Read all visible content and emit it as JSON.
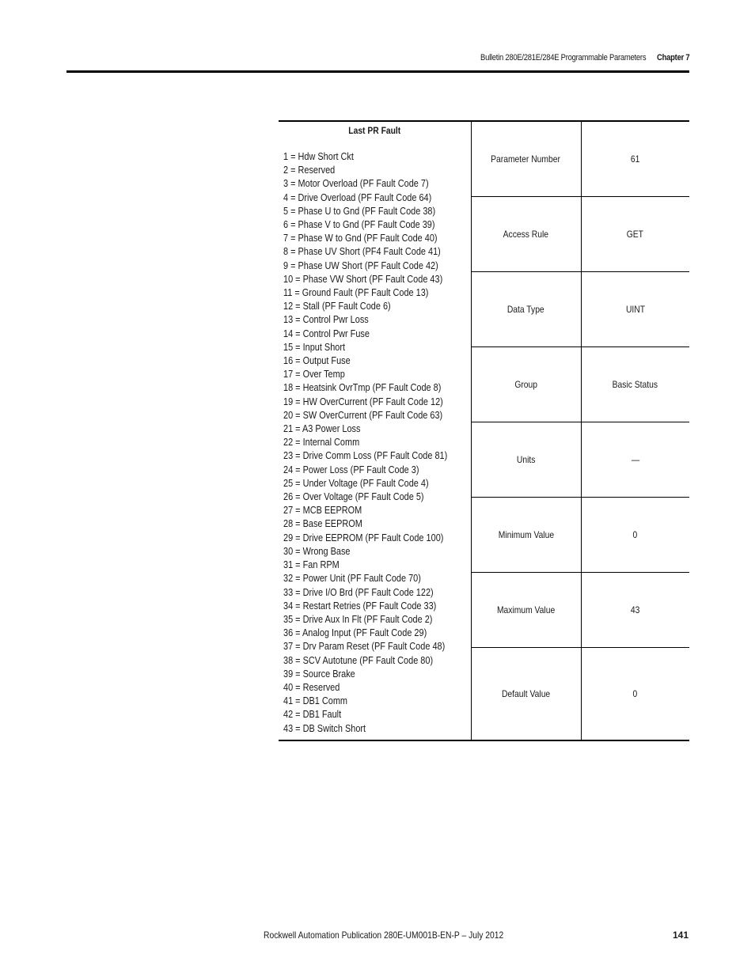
{
  "header": {
    "title": "Bulletin 280E/281E/284E Programmable Parameters",
    "chapter": "Chapter 7"
  },
  "parameter": {
    "name": "Last PR Fault",
    "enum_values": [
      "1 = Hdw Short Ckt",
      "2 = Reserved",
      "3 = Motor Overload  (PF Fault Code 7)",
      "4 = Drive Overload  (PF Fault Code 64)",
      "5 = Phase U to Gnd  (PF Fault Code 38)",
      "6 = Phase V to Gnd  (PF Fault Code 39)",
      "7 = Phase W to Gnd  (PF Fault Code 40)",
      "8 = Phase UV Short  (PF4 Fault Code 41)",
      "9 = Phase UW Short (PF Fault Code 42)",
      "10 = Phase VW Short  (PF Fault Code 43)",
      "11 = Ground Fault (PF Fault Code 13)",
      "12 = Stall  (PF Fault Code 6)",
      "13 = Control Pwr Loss",
      "14 = Control Pwr Fuse",
      "15 = Input Short",
      "16 = Output Fuse",
      "17 = Over Temp",
      "18 = Heatsink OvrTmp (PF Fault Code 8)",
      "19 = HW OverCurrent  (PF Fault Code 12)",
      "20 = SW OverCurrent  (PF Fault Code 63)",
      "21 = A3 Power Loss",
      "22 = Internal Comm",
      "23 = Drive Comm Loss  (PF Fault Code 81)",
      "24 = Power Loss  (PF Fault Code 3)",
      "25 = Under Voltage  (PF Fault Code 4)",
      "26 = Over Voltage  (PF Fault Code 5)",
      "27 = MCB EEPROM",
      "28 = Base EEPROM",
      "29 = Drive EEPROM  (PF Fault Code 100)",
      "30 = Wrong Base",
      "31 = Fan RPM",
      "32 = Power Unit  (PF Fault Code 70)",
      "33 = Drive I/O Brd  (PF Fault Code 122)",
      "34 = Restart Retries  (PF Fault Code 33)",
      "35 = Drive Aux In Flt (PF Fault Code 2)",
      "36 = Analog Input  (PF Fault Code 29)",
      "37 = Drv Param Reset (PF Fault Code 48)",
      "38 = SCV Autotune  (PF Fault Code 80)",
      "39 = Source Brake",
      "40 = Reserved",
      "41 = DB1 Comm",
      "42 = DB1 Fault",
      "43 = DB Switch Short"
    ],
    "attributes": [
      {
        "label": "Parameter Number",
        "value": "61"
      },
      {
        "label": "Access Rule",
        "value": "GET"
      },
      {
        "label": "Data Type",
        "value": "UINT"
      },
      {
        "label": "Group",
        "value": "Basic Status"
      },
      {
        "label": "Units",
        "value": "—"
      },
      {
        "label": "Minimum Value",
        "value": "0"
      },
      {
        "label": "Maximum Value",
        "value": "43"
      },
      {
        "label": "Default Value",
        "value": "0"
      }
    ]
  },
  "footer": {
    "publication": "Rockwell Automation Publication 280E-UM001B-EN-P – July 2012",
    "page_number": "141"
  }
}
